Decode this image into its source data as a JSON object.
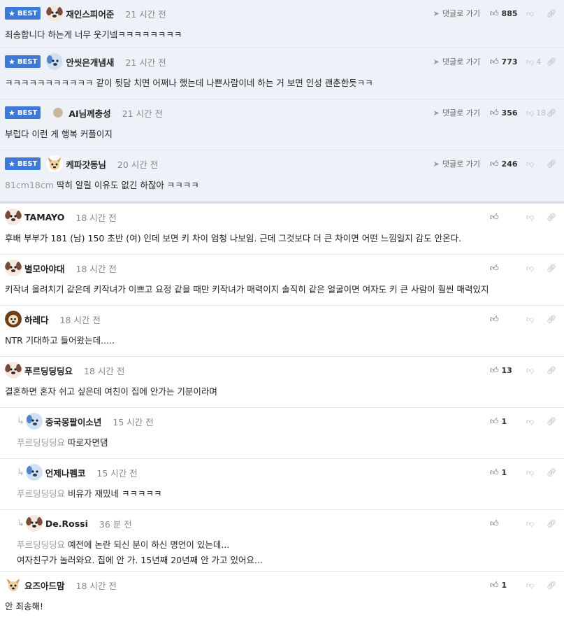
{
  "labels": {
    "best": "BEST",
    "reply_link": "댓글로 가기"
  },
  "comments": [
    {
      "nick": "재인스피어준",
      "time": "21 시간 전",
      "likes": "885",
      "dislikes": "",
      "text": "죄송합니다 하는게 너무 웃기넼ㅋㅋㅋㅋㅋㅋㅋㅋ",
      "avatar_icon": "dog-avatar-icon"
    },
    {
      "nick": "안씻은개냄새",
      "time": "21 시간 전",
      "likes": "773",
      "dislikes": "4",
      "text": "ㅋㅋㅋㅋㅋㅋㅋㅋㅋㅋㅋ 같이 뒷담 치면 어쩌나 했는데 나쁜사람이네 하는 거 보면 인성 괜춘한듯ㅋㅋ",
      "avatar_icon": "blue-dog-avatar-icon"
    },
    {
      "nick": "AI님께충성",
      "time": "21 시간 전",
      "likes": "356",
      "dislikes": "18",
      "text": "부럽다 이런 게 행복 커플이지",
      "avatar_icon": "round-avatar-icon"
    },
    {
      "nick": "케파갓동님",
      "time": "20 시간 전",
      "likes": "246",
      "dislikes": "",
      "mention": "81cm18cm",
      "text": "딱히 알릴 이유도 없긴 하잖아 ㅋㅋㅋㅋ",
      "avatar_icon": "chihuahua-avatar-icon"
    },
    {
      "nick": "TAMAYO",
      "time": "18 시간 전",
      "likes": "",
      "dislikes": "",
      "text": "후배 부부가 181 (남) 150 초반 (여) 인데 보면 키 차이 엄청 나보임. 근데 그것보다 더 큰 차이면 어떤 느낌일지 감도 안온다.",
      "avatar_icon": "dog-avatar-icon"
    },
    {
      "nick": "별모아야대",
      "time": "18 시간 전",
      "likes": "",
      "dislikes": "",
      "text": "키작녀 올려치기 같은데 키작녀가 이쁘고 요정 같을 때만 키작녀가 매력이지 솔직히 같은 얼굴이면 여자도 키 큰 사람이 훨씬 매력있지",
      "avatar_icon": "dog-avatar-icon"
    },
    {
      "nick": "하레다",
      "time": "18 시간 전",
      "likes": "",
      "dislikes": "",
      "text": "NTR 기대하고 들어왔는데.....",
      "avatar_icon": "lion-avatar-icon"
    },
    {
      "nick": "푸르딩딩딩요",
      "time": "18 시간 전",
      "likes": "13",
      "dislikes": "",
      "text": "결혼하면 혼자 쉬고 싶은데 여친이 집에 안가는 기분이라며",
      "avatar_icon": "dog-avatar-icon"
    },
    {
      "nick": "중국몽팔이소년",
      "time": "15 시간 전",
      "likes": "1",
      "dislikes": "",
      "mention": "푸르딩딩딩요",
      "text": "따로자면댐",
      "avatar_icon": "blue-dog-avatar-icon"
    },
    {
      "nick": "언제나펨코",
      "time": "15 시간 전",
      "likes": "1",
      "dislikes": "",
      "mention": "푸르딩딩딩요",
      "text": "비유가 재밌네 ㅋㅋㅋㅋㅋ",
      "avatar_icon": "blue-dog-avatar-icon"
    },
    {
      "nick": "De.Rossi",
      "time": "36 분 전",
      "likes": "",
      "dislikes": "",
      "mention": "푸르딩딩딩요",
      "text": "예전에 논란 되신 분이 하신 명언이 있는데...",
      "text2": "여자친구가 놀러와요. 집에 안 가. 15년째 20년째 안 가고 있어요...",
      "avatar_icon": "dog-avatar-icon"
    },
    {
      "nick": "요즈아드맘",
      "time": "18 시간 전",
      "likes": "1",
      "dislikes": "",
      "text": "안 죄송해!",
      "avatar_icon": "chihuahua-avatar-icon"
    }
  ],
  "colors": {
    "best_badge": "#3d79d6",
    "best_bg": "#eef2f8"
  }
}
